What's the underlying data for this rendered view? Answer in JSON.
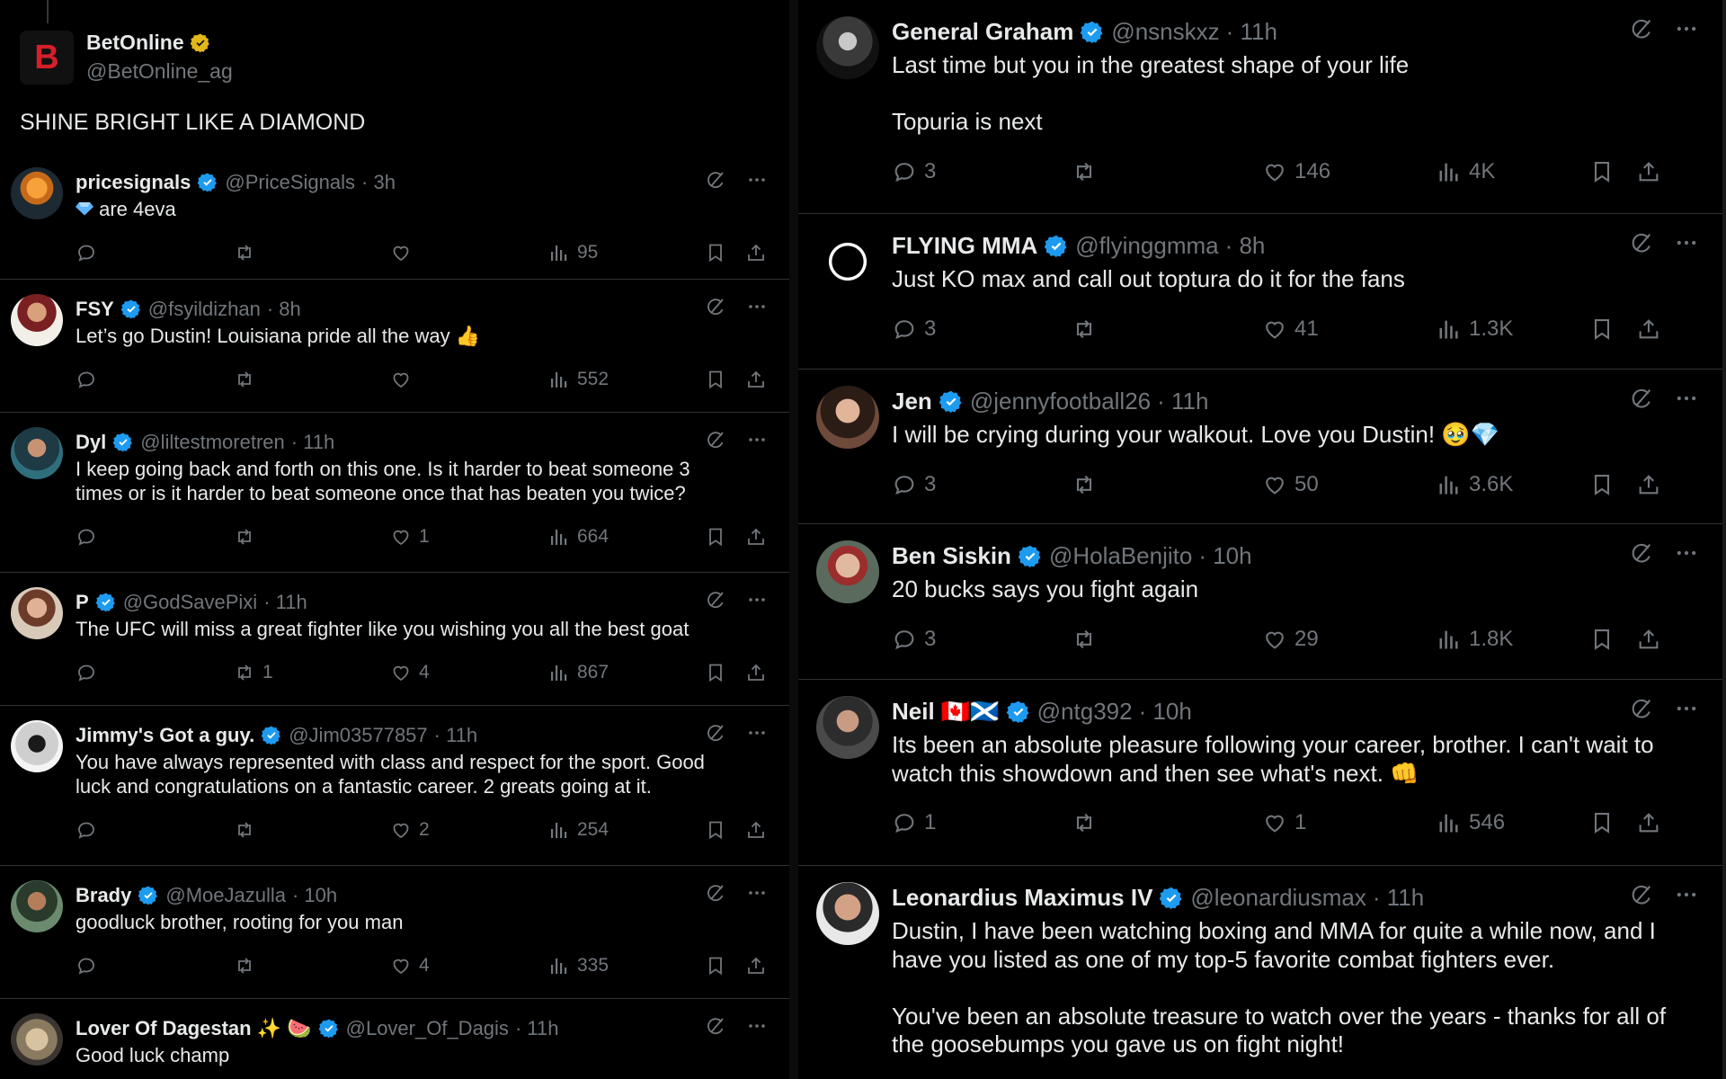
{
  "left": {
    "original": {
      "name": "BetOnline",
      "handle": "@BetOnline_ag",
      "avatar_letter": "B",
      "text": "SHINE BRIGHT LIKE A DIAMOND"
    },
    "replies": [
      {
        "name": "pricesignals",
        "handle": "@PriceSignals",
        "time": "· 3h",
        "text": [
          "are 4eva"
        ],
        "gem_prefix": true,
        "reply_count": "",
        "retweet_count": "",
        "like_count": "",
        "views": "95"
      },
      {
        "name": "FSY",
        "handle": "@fsyildizhan",
        "time": "· 8h",
        "text": [
          "Let’s go Dustin! Louisiana pride all the way 👍"
        ],
        "reply_count": "",
        "retweet_count": "",
        "like_count": "",
        "views": "552"
      },
      {
        "name": "Dyl",
        "handle": "@liltestmoretren",
        "time": "· 11h",
        "text": [
          "I keep going back and forth on this one. Is it harder to beat someone 3",
          "times or is it harder to beat someone once that has beaten you twice?"
        ],
        "reply_count": "",
        "retweet_count": "",
        "like_count": "1",
        "views": "664"
      },
      {
        "name": "P",
        "handle": "@GodSavePixi",
        "time": "· 11h",
        "text": [
          "The UFC will miss a great fighter like you wishing you all the best goat"
        ],
        "reply_count": "",
        "retweet_count": "1",
        "like_count": "4",
        "views": "867"
      },
      {
        "name": "Jimmy's Got a guy.",
        "handle": "@Jim03577857",
        "time": "· 11h",
        "text": [
          "You have always represented with class and respect for the sport. Good",
          "luck and congratulations on a  fantastic career. 2 greats going at it."
        ],
        "reply_count": "",
        "retweet_count": "",
        "like_count": "2",
        "views": "254"
      },
      {
        "name": "Brady",
        "handle": "@MoeJazulla",
        "time": "· 10h",
        "text": [
          "goodluck brother, rooting for you man"
        ],
        "reply_count": "",
        "retweet_count": "",
        "like_count": "4",
        "views": "335"
      },
      {
        "name": "Lover Of Dagestan ✨ 🍉",
        "handle": "@Lover_Of_Dagis",
        "time": "· 11h",
        "text": [
          "Good luck champ"
        ],
        "reply_count": "",
        "retweet_count": "",
        "like_count": "",
        "views": ""
      }
    ]
  },
  "right": {
    "replies": [
      {
        "name": "General Graham",
        "handle": "@nsnskxz",
        "time": "· 11h",
        "text": [
          "Last time but you in the greatest shape of your life",
          "",
          "Topuria is next"
        ],
        "reply_count": "3",
        "retweet_count": "",
        "like_count": "146",
        "views": "4K"
      },
      {
        "name": "FLYING MMA",
        "handle": "@flyinggmma",
        "time": "· 8h",
        "text": [
          "Just KO max and call out toptura do it for the fans"
        ],
        "reply_count": "3",
        "retweet_count": "",
        "like_count": "41",
        "views": "1.3K"
      },
      {
        "name": "Jen",
        "handle": "@jennyfootball26",
        "time": "· 11h",
        "text": [
          "I will be crying during your walkout. Love you Dustin! 🥹💎"
        ],
        "reply_count": "3",
        "retweet_count": "",
        "like_count": "50",
        "views": "3.6K"
      },
      {
        "name": "Ben Siskin",
        "handle": "@HolaBenjito",
        "time": "· 10h",
        "text": [
          "20 bucks says you fight again"
        ],
        "reply_count": "3",
        "retweet_count": "",
        "like_count": "29",
        "views": "1.8K"
      },
      {
        "name": "Neil 🇨🇦🏴󠁧󠁢󠁳󠁣󠁴󠁿",
        "handle": "@ntg392",
        "time": "· 10h",
        "text": [
          "Its been an absolute pleasure following your career, brother. I can't wait to",
          "watch this showdown and then see what's next. 👊"
        ],
        "reply_count": "1",
        "retweet_count": "",
        "like_count": "1",
        "views": "546"
      },
      {
        "name": "Leonardius Maximus IV",
        "handle": "@leonardiusmax",
        "time": "· 11h",
        "text": [
          "Dustin, I have been watching boxing and MMA for quite a while now, and I",
          "have you listed as one of my top-5 favorite combat fighters ever.",
          "",
          "You've been an absolute treasure to watch over the years - thanks for all of",
          "the goosebumps you gave us on fight night!"
        ],
        "reply_count": "",
        "retweet_count": "",
        "like_count": "",
        "views": ""
      }
    ]
  },
  "colors": {
    "background": "#000000",
    "text": "#e7e9ea",
    "muted": "#71767b",
    "verified_blue": "#1d9bf0",
    "verified_gold": "#e2b719",
    "divider": "#2f3336",
    "brand_red": "#d51f2a"
  },
  "icons": [
    "reply-icon",
    "retweet-icon",
    "like-icon",
    "views-icon",
    "bookmark-icon",
    "share-icon",
    "grok-icon",
    "more-icon",
    "verified-badge"
  ]
}
